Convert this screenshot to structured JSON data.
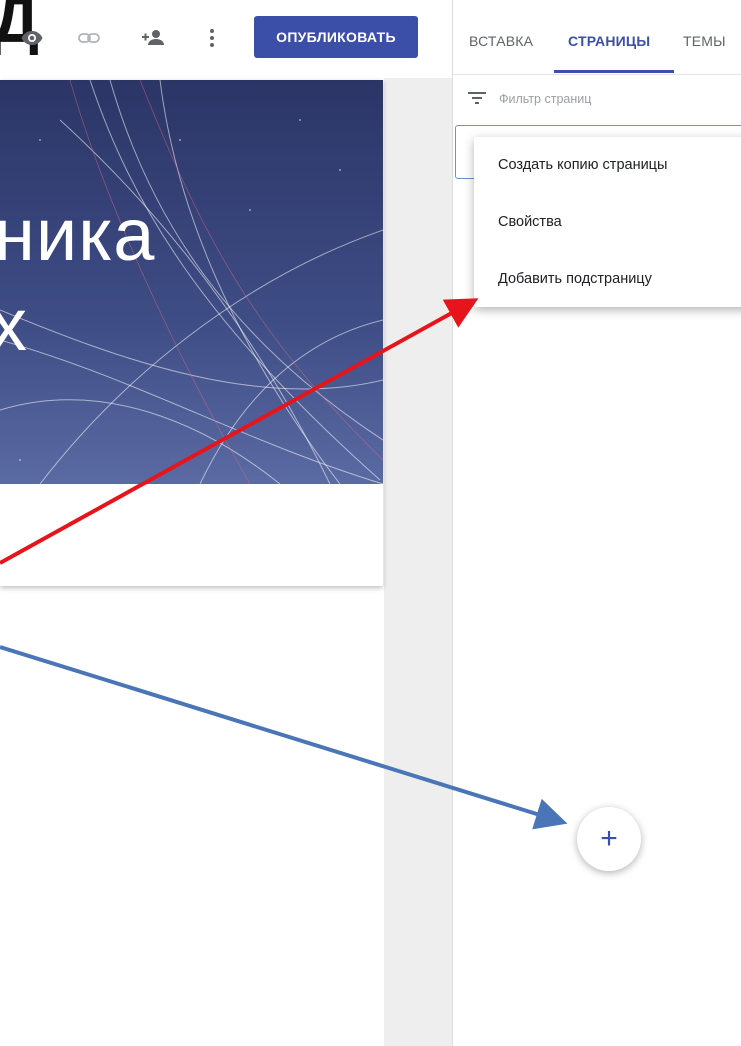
{
  "toolbar": {
    "partial_heading": "Д",
    "publish_label": "ОПУБЛИКОВАТЬ",
    "icons": [
      "eye-icon",
      "link-icon",
      "add-person-icon",
      "more-vert-icon"
    ]
  },
  "page": {
    "banner_line1": "ника",
    "banner_line2": "х"
  },
  "panel": {
    "tabs": [
      {
        "label": "ВСТАВКА",
        "active": false
      },
      {
        "label": "СТРАНИЦЫ",
        "active": true
      },
      {
        "label": "ТЕМЫ",
        "active": false
      }
    ],
    "filter_placeholder": "Фильтр страниц"
  },
  "context_menu": {
    "items": [
      {
        "label": "Создать копию страницы"
      },
      {
        "label": "Свойства"
      },
      {
        "label": "Добавить подстраницу"
      }
    ]
  },
  "fab": {
    "label": "+"
  },
  "colors": {
    "accent": "#3b4fa8",
    "annotation_red": "#e8141b",
    "annotation_blue": "#4a76b8",
    "banner_bg": "#2f3a6e"
  }
}
